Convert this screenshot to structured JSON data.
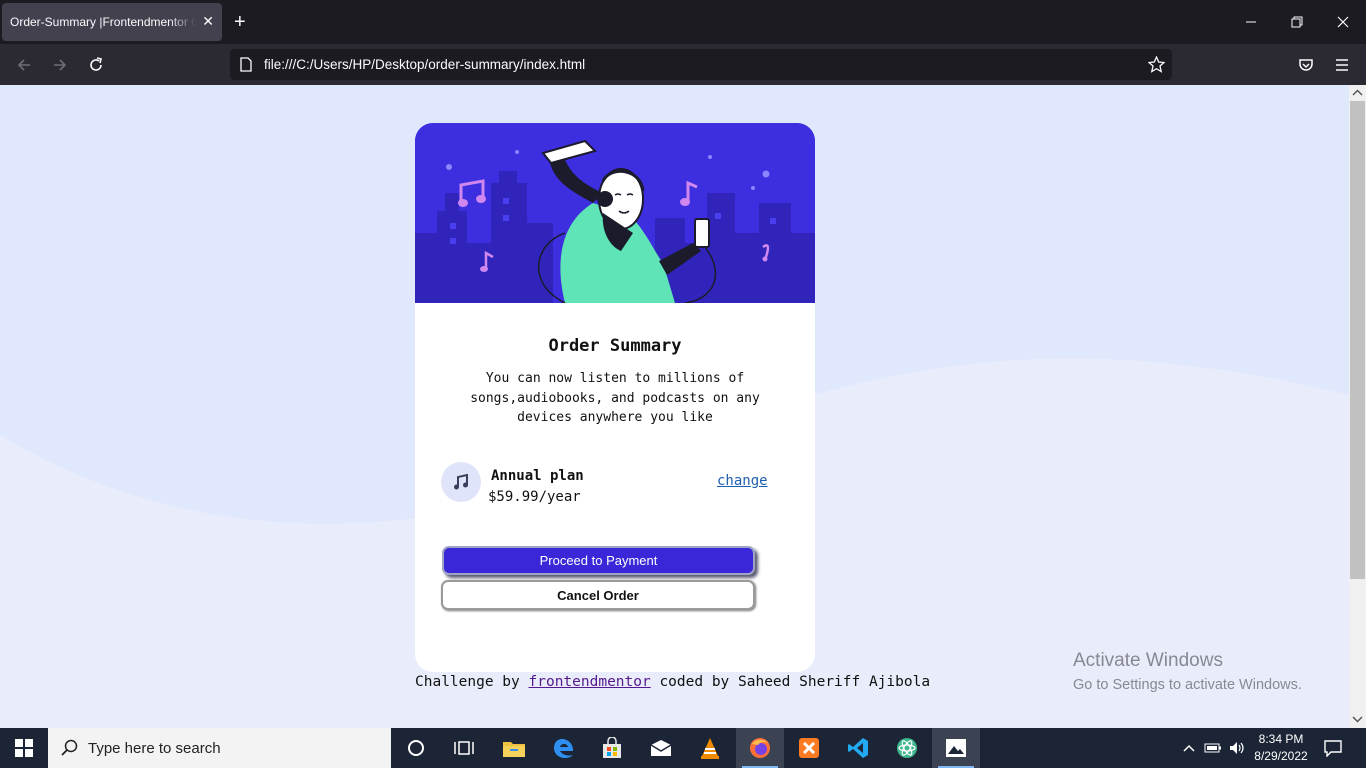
{
  "browser": {
    "tab_title": "Order-Summary |Frontendmentor Challenge",
    "url": "file:///C:/Users/HP/Desktop/order-summary/index.html"
  },
  "card": {
    "title": "Order Summary",
    "description": "You can now listen to millions of songs,audiobooks, and podcasts on any devices anywhere you like",
    "plan_name": "Annual plan",
    "plan_price": "$59.99/year",
    "change_label": "change",
    "proceed_label": "Proceed to Payment",
    "cancel_label": "Cancel Order"
  },
  "attribution": {
    "prefix": "Challenge by ",
    "link": "frontendmentor",
    "suffix": " coded by Saheed Sheriff Ajibola"
  },
  "watermark": {
    "title": "Activate Windows",
    "subtitle": "Go to Settings to activate Windows."
  },
  "taskbar": {
    "search_placeholder": "Type here to search",
    "time": "8:34 PM",
    "date": "8/29/2022",
    "apps": [
      "cortana-icon",
      "task-view-icon",
      "file-explorer-icon",
      "edge-icon",
      "store-icon",
      "mail-icon",
      "vlc-icon",
      "firefox-icon",
      "xampp-icon",
      "vscode-icon",
      "atom-icon",
      "photos-icon"
    ]
  },
  "colors": {
    "page_bg": "#e0e8fd",
    "accent": "#3a28d8",
    "hero_bg": "#3d2ee0",
    "link": "#1f5fb0"
  }
}
